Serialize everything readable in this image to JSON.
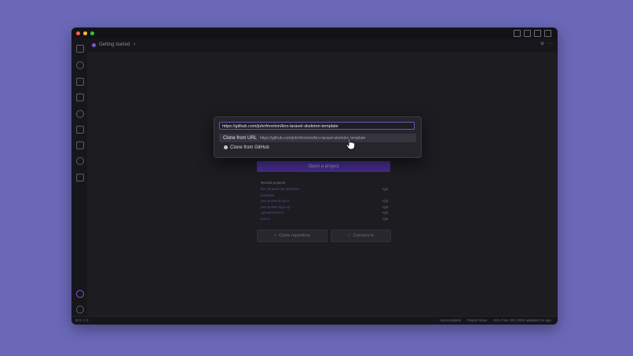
{
  "window": {
    "tab_title": "Getting started",
    "tab_close": "×",
    "tab_right_icons": [
      "⊕",
      "⋯"
    ]
  },
  "activity_bar": {
    "icons": [
      "files-icon",
      "search-icon",
      "source-control-icon",
      "run-debug-icon",
      "extensions-icon",
      "kiro-icon",
      "specs-icon",
      "shield-icon",
      "phone-icon"
    ],
    "bottom_icons": [
      "account-icon",
      "settings-gear-icon"
    ]
  },
  "quick_pick": {
    "input_value": "https://github.com/johnfmorton/kiro-laravel-skeleton-template",
    "items": [
      {
        "label": "Clone from URL",
        "description": "https://github.com/johnfmorton/kiro-laravel-skeleton-template"
      },
      {
        "label": "Clone from GitHub",
        "icon": "github-icon"
      }
    ]
  },
  "welcome": {
    "open_project": "Open a project",
    "recent_title": "Recent projects",
    "recent": [
      {
        "name": "kiro-laravel-site-skeleton-",
        "path": "~/git"
      },
      {
        "name": "template",
        "path": ""
      },
      {
        "name": "pwr-poster-project",
        "path": "~/git"
      },
      {
        "name": "pwr-poster-sign-up",
        "path": "~/git"
      },
      {
        "name": "upload-drive-in",
        "path": "~/git"
      },
      {
        "name": "test-2",
        "path": "~/git"
      }
    ],
    "clone_repo": "Clone repository",
    "connect_to": "Connect to"
  },
  "status_bar": {
    "left": [
      "⊗ 0  ⚠ 0"
    ],
    "right": [
      "Autocomplete",
      "Report issue",
      "Kiro Free: 0/0 | 0/50 updated 1m ago"
    ]
  },
  "colors": {
    "accent": "#6a58b8",
    "window_bg": "#1b1b20",
    "desktop_bg": "#6b68b8"
  }
}
